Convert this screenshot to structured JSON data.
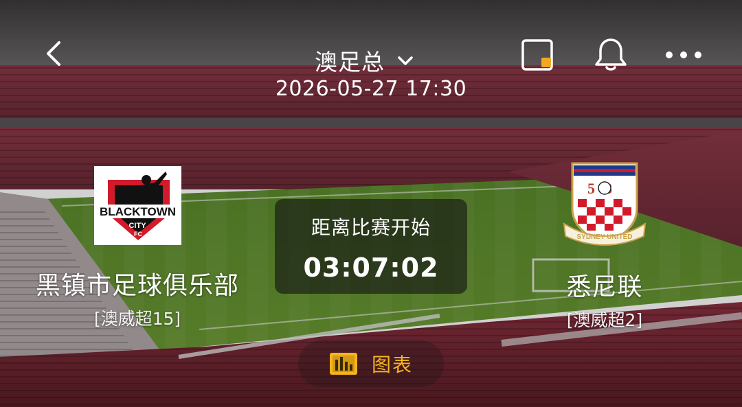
{
  "header": {
    "league": "澳足总",
    "match_time": "2026-05-27 17:30"
  },
  "home_team": {
    "name": "黑镇市足球俱乐部",
    "rank": "[澳威超15]",
    "logo_text_top": "BLACKTOWN",
    "logo_text_city": "CITY",
    "logo_text_fc": "FC"
  },
  "away_team": {
    "name": "悉尼联",
    "rank": "[澳威超2]",
    "logo_numbers": "58",
    "logo_banner": "SYDNEY UNITED"
  },
  "countdown": {
    "label": "距离比赛开始",
    "time": "03:07:02"
  },
  "chart_button": {
    "label": "图表"
  },
  "colors": {
    "accent": "#f5b51c",
    "pip_dot": "#f5a623",
    "stands": "#7a2a3a",
    "pitch": "#4a7a2a"
  },
  "icons": [
    "back-icon",
    "chevron-down-icon",
    "picture-in-picture-icon",
    "bell-icon",
    "more-icon",
    "bar-chart-icon"
  ]
}
